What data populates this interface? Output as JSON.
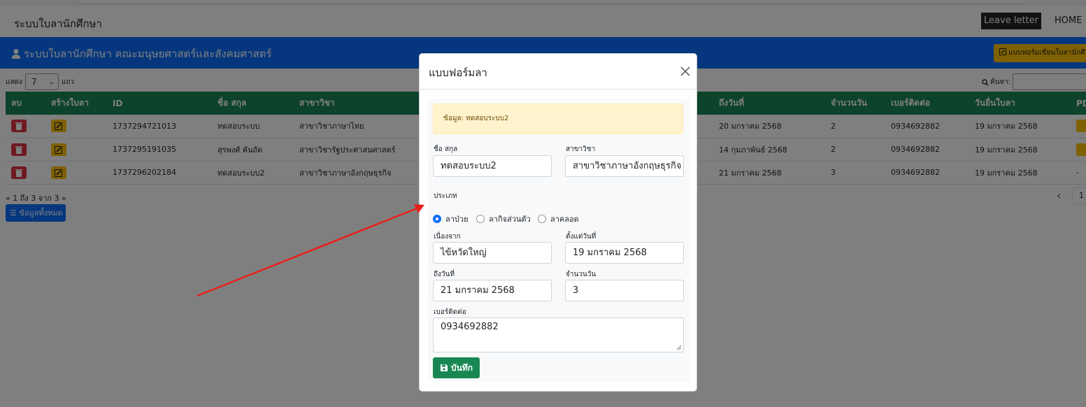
{
  "navbar": {
    "brand": "ระบบใบลานักศึกษา",
    "leave_letter": "Leave letter",
    "home": "HOME"
  },
  "header": {
    "title": "ระบบใบลานักศึกษา คณะมนุษยศาสตร์และสังคมศาสตร์",
    "form_button": "แบบฟอร์มเขียนใบลานักศึ"
  },
  "controls": {
    "show": "แสดง",
    "rows_value": "7",
    "rows": "แถว",
    "search": "ค้นหา:"
  },
  "table": {
    "columns": [
      "ลบ",
      "สร้างใบลา",
      "ID",
      "ชื่อ สกุล",
      "สาขาวิชา",
      "ถึงวันที่",
      "จำนวนวัน",
      "เบอร์ติดต่อ",
      "วันยื่นใบลา",
      "PD"
    ],
    "rows": [
      {
        "id": "1737294721013",
        "name": "ทดสอบระบบ",
        "major": "สาขาวิชาภาษาไทย",
        "to_date": "20 มกราคม 2568",
        "days": "2",
        "phone": "0934692882",
        "submitted": "19 มกราคม 2568",
        "pdf": ""
      },
      {
        "id": "1737295191035",
        "name": "สุรพงศ์ คันถัด",
        "major": "สาขาวิชารัฐประศาสนศาสตร์",
        "to_date": "14 กุมภาพันธ์ 2568",
        "days": "2",
        "phone": "0934692882",
        "submitted": "19 มกราคม 2568",
        "pdf": ""
      },
      {
        "id": "1737296202184",
        "name": "ทดสอบระบบ2",
        "major": "สาขาวิชาภาษาอังกฤษธุรกิจ",
        "to_date": "21 มกราคม 2568",
        "days": "3",
        "phone": "0934692882",
        "submitted": "19 มกราคม 2568",
        "pdf": "-"
      }
    ]
  },
  "pager": {
    "info": "1 ถึง 3 จาก 3",
    "all_button": "ข้อมูลทั้งหมด",
    "page": "1"
  },
  "modal": {
    "title": "แบบฟอร์มลา",
    "alert": "ข้อมูล: ทดสอบระบบ2",
    "name_label": "ชื่อ สกุล",
    "name_value": "ทดสอบระบบ2",
    "major_label": "สาขาวิชา",
    "major_value": "สาขาวิชาภาษาอังกฤษธุรกิจ",
    "type_label": "ประเภท",
    "types": [
      "ลาป่วย",
      "ลากิจส่วนตัว",
      "ลาคลอด"
    ],
    "selected_type": 0,
    "reason_label": "เนื่องจาก",
    "reason_value": "ไข้หวัดใหญ่",
    "from_label": "ตั้งแต่วันที่",
    "from_value": "19 มกราคม 2568",
    "to_label": "ถึงวันที่",
    "to_value": "21 มกราคม 2568",
    "days_label": "จำนวนวัน",
    "days_value": "3",
    "phone_label": "เบอร์ติดต่อ",
    "phone_value": "0934692882",
    "save": "บันทึก"
  },
  "colors": {
    "primary": "#0d6efd",
    "success": "#198754",
    "danger": "#dc3545",
    "warning": "#ffc107",
    "annotation": "#e8201c"
  }
}
